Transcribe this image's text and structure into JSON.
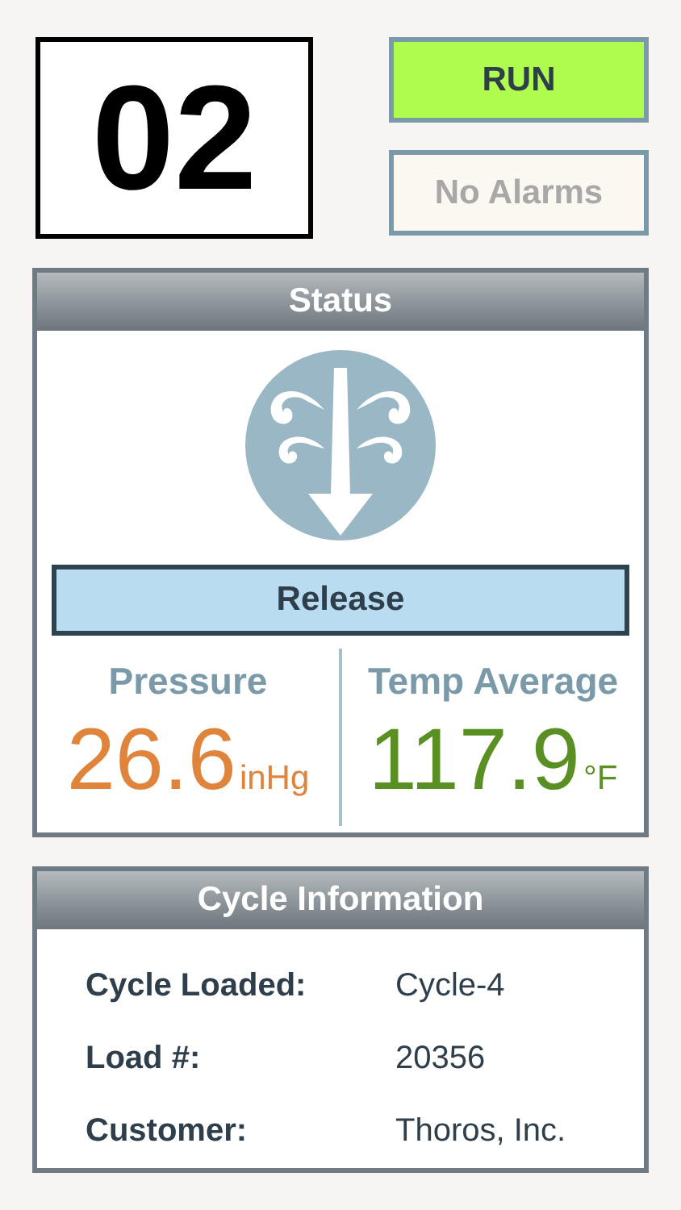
{
  "chamber": "02",
  "indicators": [
    {
      "label": "RUN",
      "active": true
    },
    {
      "label": "No Alarms",
      "active": false
    }
  ],
  "status": {
    "title": "Status",
    "phase": "Release",
    "metrics": [
      {
        "label": "Pressure",
        "value": "26.6",
        "unit": "inHg",
        "color": "#e0843c"
      },
      {
        "label": "Temp Average",
        "value": "117.9",
        "unit": "°F",
        "color": "#5a8f24"
      }
    ]
  },
  "cycle_info": {
    "title": "Cycle Information",
    "rows": [
      {
        "label": "Cycle Loaded:",
        "value": "Cycle-4"
      },
      {
        "label": "Load #:",
        "value": "20356"
      },
      {
        "label": "Customer:",
        "value": "Thoros, Inc."
      }
    ]
  }
}
